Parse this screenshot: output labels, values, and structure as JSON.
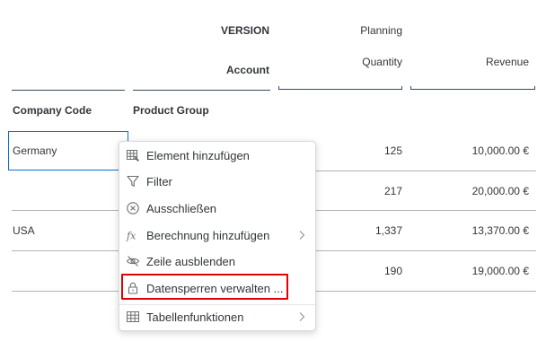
{
  "header": {
    "version": "VERSION",
    "account": "Account",
    "planning": "Planning",
    "quantity": "Quantity",
    "revenue": "Revenue",
    "company_code": "Company Code",
    "product_group": "Product Group"
  },
  "rows": [
    {
      "company": "Germany",
      "quantity": "125",
      "revenue": "10,000.00 €"
    },
    {
      "company": "",
      "quantity": "217",
      "revenue": "20,000.00 €"
    },
    {
      "company": "USA",
      "quantity": "1,337",
      "revenue": "13,370.00 €"
    },
    {
      "company": "",
      "quantity": "190",
      "revenue": "19,000.00 €"
    }
  ],
  "menu": {
    "items": [
      {
        "label": "Element hinzufügen",
        "icon": "table-add-icon"
      },
      {
        "label": "Filter",
        "icon": "filter-icon"
      },
      {
        "label": "Ausschließen",
        "icon": "exclude-icon"
      },
      {
        "label": "Berechnung hinzufügen",
        "icon": "fx-icon",
        "submenu": true
      },
      {
        "label": "Zeile ausblenden",
        "icon": "hide-icon"
      },
      {
        "label": "Datensperren verwalten ...",
        "icon": "lock-icon"
      },
      {
        "label": "Tabellenfunktionen",
        "icon": "table-icon",
        "submenu": true
      }
    ]
  },
  "colors": {
    "accent": "#0a6ed1",
    "highlight": "#e00000",
    "header_line": "#354a5f"
  }
}
